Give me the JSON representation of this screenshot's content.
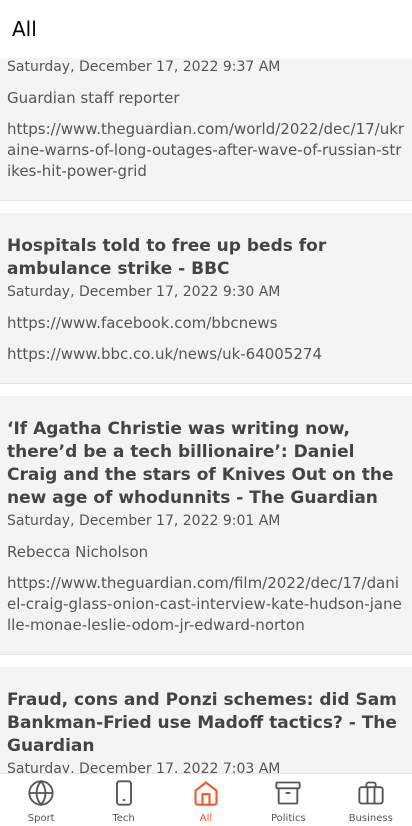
{
  "header": {
    "title": "All"
  },
  "articles": [
    {
      "date": "Saturday, December 17, 2022 9:37 AM",
      "author": "Guardian staff reporter",
      "url": "https://www.theguardian.com/world/2022/dec/17/ukraine-warns-of-long-outages-after-wave-of-russian-strikes-hit-power-grid"
    },
    {
      "title": "Hospitals told to free up beds for ambulance strike - BBC",
      "date": "Saturday, December 17, 2022 9:30 AM",
      "author": "https://www.facebook.com/bbcnews",
      "url": "https://www.bbc.co.uk/news/uk-64005274"
    },
    {
      "title": "‘If Agatha Christie was writing now, there’d be a tech billionaire’: Daniel Craig and the stars of Knives Out on the new age of whodunnits - The Guardian",
      "date": "Saturday, December 17, 2022 9:01 AM",
      "author": "Rebecca Nicholson",
      "url": "https://www.theguardian.com/film/2022/dec/17/daniel-craig-glass-onion-cast-interview-kate-hudson-janelle-monae-leslie-odom-jr-edward-norton"
    },
    {
      "title": "Fraud, cons and Ponzi schemes: did Sam Bankman-Fried use Madoff tactics? - The Guardian",
      "date": "Saturday, December 17, 2022 7:03 AM"
    }
  ],
  "nav": {
    "items": [
      {
        "label": "Sport",
        "icon": "globe-icon"
      },
      {
        "label": "Tech",
        "icon": "phone-icon"
      },
      {
        "label": "All",
        "icon": "home-icon"
      },
      {
        "label": "Politics",
        "icon": "archive-icon"
      },
      {
        "label": "Business",
        "icon": "briefcase-icon"
      }
    ],
    "active": "All",
    "active_color": "#f05a28"
  }
}
